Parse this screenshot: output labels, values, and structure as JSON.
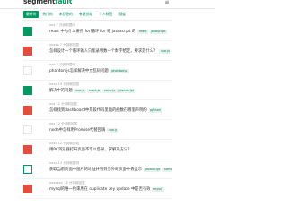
{
  "brand": {
    "name_prefix": "segment",
    "name_suffix": "fault"
  },
  "tabs": [
    {
      "label": "最新的"
    },
    {
      "label": "热门的"
    },
    {
      "label": "未回答的"
    },
    {
      "label": "有悬赏的"
    },
    {
      "label": "个人标签"
    },
    {
      "label": "频道"
    }
  ],
  "questions": [
    {
      "state": "accepted",
      "stat": "",
      "meta": "xxx 7 分钟前提问",
      "title": "react 中为什么要用 for 循环 for 或 javascript 的",
      "tags": [
        "react",
        "javascript"
      ]
    },
    {
      "state": "unanswered",
      "stat": "",
      "meta": "xxxxx 7 分钟前回答",
      "title": "怎样设计一个循环输入只能录用数一个数字给定，要求是什么？",
      "tags": [
        "vue.js"
      ]
    },
    {
      "state": "normal",
      "stat": "",
      "meta": "xxx 9 分钟前提问",
      "title": "phantomjs怎样解决中文乱码问题",
      "tags": [
        "phantomjs"
      ]
    },
    {
      "state": "accepted",
      "stat": "",
      "meta": "xxxx 10 分钟前回答",
      "title": "解决中的问题",
      "tags": [
        "vue.js",
        "react.js",
        "node.js",
        "javascript"
      ]
    },
    {
      "state": "unanswered",
      "stat": "",
      "meta": "xxx 11 分钟前回答",
      "title": "怎样找到dashboard中某段代码里面的函数在哪里声明的",
      "tags": [
        "python"
      ]
    },
    {
      "state": "normal",
      "stat": "",
      "meta": "xxx 12 分钟前回答",
      "title": "node中怎样用Promise代替回调",
      "tags": [
        "vue.js"
      ]
    },
    {
      "state": "unanswered",
      "stat": "",
      "meta": "xxxx 12 分钟前回答",
      "title": "用PC浏览器打开页面不可以登录，求解决方法？",
      "tags": []
    },
    {
      "state": "answered",
      "stat": "",
      "meta": "xxxx 12 分钟前提问",
      "title": "获取当前页面中图片的地址并用到另外的页面中去显示",
      "tags": [
        "javascript",
        "html5"
      ]
    },
    {
      "state": "unanswered",
      "stat": "",
      "meta": "xxxxxxx 13 分钟前回答",
      "title": "mysql的唯一约束用在 duplicate key update 中是否有效",
      "tags": [
        "mysql"
      ]
    }
  ]
}
